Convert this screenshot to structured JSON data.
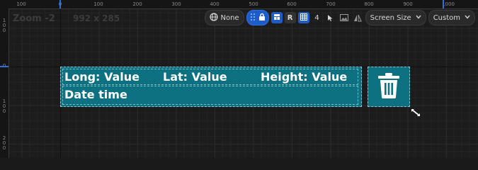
{
  "designer": {
    "zoom_label": "Zoom -2",
    "resolution_label": "992 x 285"
  },
  "ruler_top": [
    "100",
    "0",
    "100",
    "200",
    "300",
    "400",
    "500",
    "600",
    "700",
    "800",
    "900",
    "1000"
  ],
  "ruler_left": [
    "1\n0\n0",
    "0",
    "1\n0\n0",
    "2\n0\n0"
  ],
  "toolbar": {
    "locale_label": "None",
    "r_label": "R",
    "grid_value": "4",
    "screen_size_label": "Screen Size",
    "custom_label": "Custom"
  },
  "widget": {
    "long_label": "Long: Value",
    "lat_label": "Lat: Value",
    "height_label": "Height: Value",
    "datetime_label": "Date time"
  },
  "icons": {
    "globe": "globe-icon",
    "lock": "lock-icon",
    "grid": "grid-icon",
    "trash": "trash-icon"
  },
  "colors": {
    "widget_bg": "#0e7181",
    "accent_blue": "#1e5dc8"
  }
}
